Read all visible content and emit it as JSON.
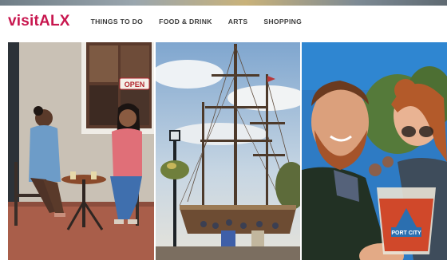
{
  "brand": {
    "logo_text": "visitALX",
    "color": "#c8174f"
  },
  "nav": {
    "items": [
      {
        "label": "THINGS TO DO"
      },
      {
        "label": "FOOD & DRINK"
      },
      {
        "label": "ARTS"
      },
      {
        "label": "SHOPPING"
      }
    ]
  },
  "photos": {
    "cafe": {
      "sign_text": "OPEN"
    },
    "cup": {
      "logo_text": "PORT CITY"
    }
  }
}
